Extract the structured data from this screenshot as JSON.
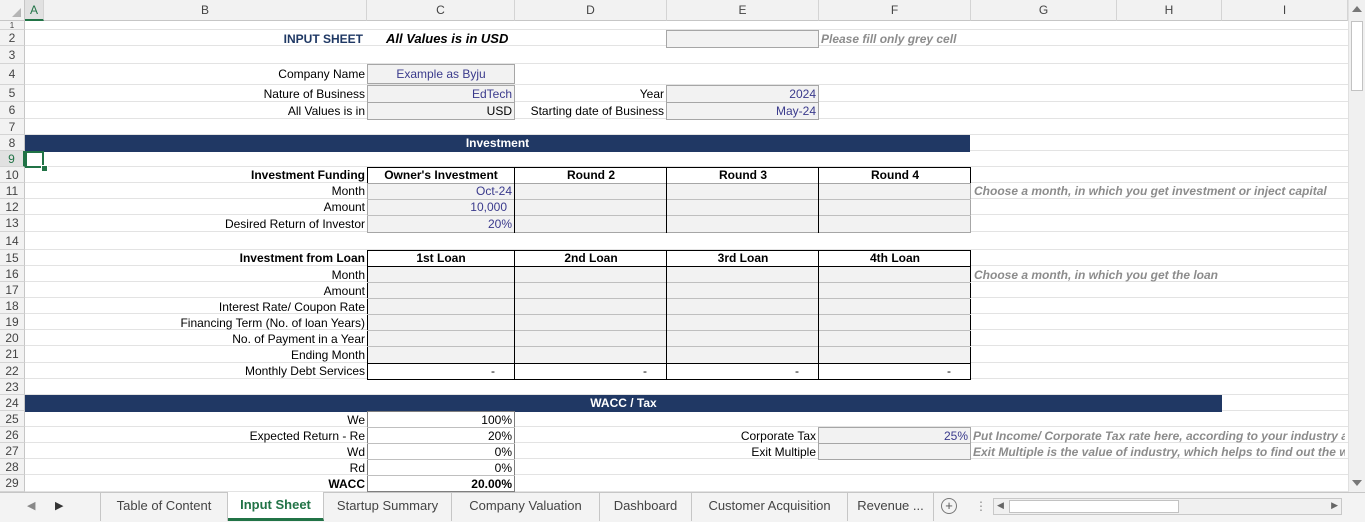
{
  "columns": [
    "A",
    "B",
    "C",
    "D",
    "E",
    "F",
    "G",
    "H",
    "I"
  ],
  "rows": [
    "1",
    "2",
    "3",
    "4",
    "5",
    "6",
    "7",
    "8",
    "9",
    "10",
    "11",
    "12",
    "13",
    "14",
    "15",
    "16",
    "17",
    "18",
    "19",
    "20",
    "21",
    "22",
    "23",
    "24",
    "25",
    "26",
    "27",
    "28",
    "29"
  ],
  "header": {
    "title": "INPUT SHEET",
    "subtitle": "All Values is in USD",
    "fill_note": "Please fill only grey cell"
  },
  "company": {
    "name_label": "Company Name",
    "name_value": "Example as Byju",
    "nature_label": "Nature of Business",
    "nature_value": "EdTech",
    "values_label": "All Values is in",
    "values_value": "USD",
    "year_label": "Year",
    "year_value": "2024",
    "start_label": "Starting date of Business",
    "start_value": "May-24"
  },
  "investment": {
    "band": "Investment",
    "funding_label": "Investment Funding",
    "columns": [
      "Owner's Investment",
      "Round 2",
      "Round 3",
      "Round 4"
    ],
    "rows": [
      {
        "label": "Month",
        "values": [
          "Oct-24",
          "",
          "",
          ""
        ]
      },
      {
        "label": "Amount",
        "values": [
          "10,000",
          "",
          "",
          ""
        ]
      },
      {
        "label": "Desired Return of Investor",
        "values": [
          "20%",
          "",
          "",
          ""
        ]
      }
    ],
    "note": "Choose a month, in which you get investment or inject capital"
  },
  "loan": {
    "label": "Investment from Loan",
    "columns": [
      "1st Loan",
      "2nd Loan",
      "3rd Loan",
      "4th Loan"
    ],
    "rows": [
      "Month",
      "Amount",
      "Interest Rate/ Coupon Rate",
      "Financing Term (No. of loan Years)",
      "No. of Payment in a Year",
      "Ending Month"
    ],
    "debt_label": "Monthly Debt Services",
    "debt_values": [
      "-",
      "-",
      "-",
      "-"
    ],
    "note": "Choose a month, in which you get the loan"
  },
  "wacc": {
    "band": "WACC / Tax",
    "rows": [
      {
        "label": "We",
        "value": "100%"
      },
      {
        "label": "Expected Return - Re",
        "value": "20%"
      },
      {
        "label": "Wd",
        "value": "0%"
      },
      {
        "label": "Rd",
        "value": "0%"
      },
      {
        "label": "WACC",
        "value": "20.00%"
      }
    ],
    "tax_label": "Corporate Tax",
    "tax_value": "25%",
    "tax_note": "Put Income/ Corporate Tax rate here, according to your industry a",
    "exit_label": "Exit Multiple",
    "exit_value": "",
    "exit_note": "Exit Multiple is the value of industry, which helps to find out the wi"
  },
  "tabs": [
    "Table of Content",
    "Input Sheet",
    "Startup Summary",
    "Company Valuation",
    "Dashboard",
    "Customer Acquisition",
    "Revenue ..."
  ],
  "active_tab": "Input Sheet",
  "colors": {
    "accent": "#217346",
    "band": "#203864",
    "grey_cell": "#f2f2f2"
  }
}
